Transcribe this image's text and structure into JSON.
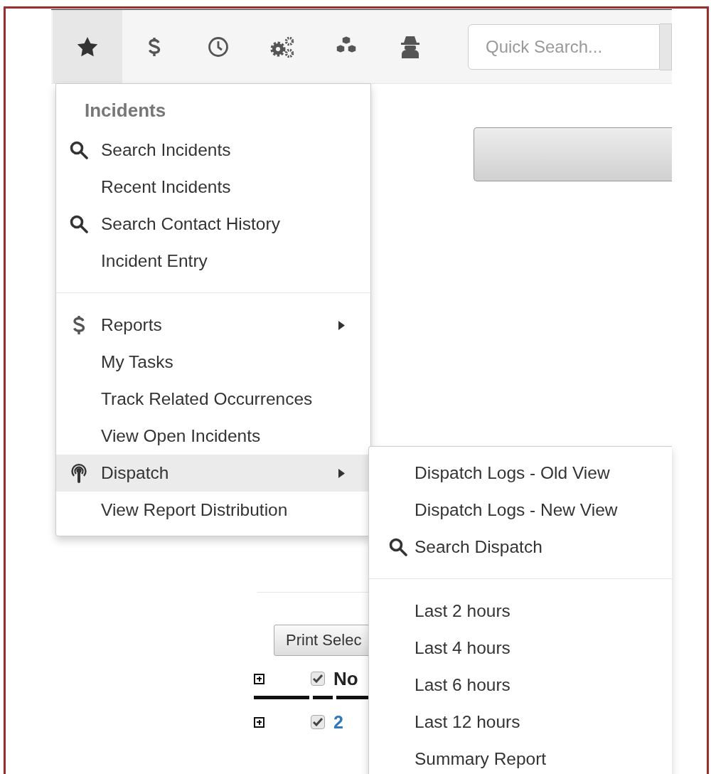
{
  "toolbar": {
    "tabs": [
      {
        "kind": "star",
        "selected": true
      },
      {
        "kind": "dollar",
        "selected": false
      },
      {
        "kind": "clock",
        "selected": false
      },
      {
        "kind": "cogs",
        "selected": false
      },
      {
        "kind": "cubes",
        "selected": false
      },
      {
        "kind": "agent",
        "selected": false
      }
    ],
    "search": {
      "placeholder": "Quick Search..."
    }
  },
  "menu": {
    "header": "Incidents",
    "sections": [
      [
        {
          "label": "Search Incidents",
          "kind": "search",
          "has_submenu": false,
          "selected": false
        },
        {
          "label": "Recent Incidents",
          "kind": "plain",
          "has_submenu": false,
          "selected": false
        },
        {
          "label": "Search Contact History",
          "kind": "search",
          "has_submenu": false,
          "selected": false
        },
        {
          "label": "Incident Entry",
          "kind": "plain",
          "has_submenu": false,
          "selected": false
        }
      ],
      [
        {
          "label": "Reports",
          "kind": "dollar",
          "has_submenu": true,
          "selected": false
        },
        {
          "label": "My Tasks",
          "kind": "plain",
          "has_submenu": false,
          "selected": false
        },
        {
          "label": "Track Related Occurrences",
          "kind": "plain",
          "has_submenu": false,
          "selected": false
        },
        {
          "label": "View Open Incidents",
          "kind": "plain",
          "has_submenu": false,
          "selected": false
        },
        {
          "label": "Dispatch",
          "kind": "broadcast",
          "has_submenu": true,
          "selected": true
        },
        {
          "label": "View Report Distribution",
          "kind": "plain",
          "has_submenu": false,
          "selected": false
        }
      ]
    ]
  },
  "submenu": {
    "sections": [
      [
        {
          "label": "Dispatch Logs - Old View",
          "kind": "plain"
        },
        {
          "label": "Dispatch Logs - New View",
          "kind": "plain"
        },
        {
          "label": "Search Dispatch",
          "kind": "search"
        }
      ],
      [
        {
          "label": "Last 2 hours",
          "kind": "plain"
        },
        {
          "label": "Last 4 hours",
          "kind": "plain"
        },
        {
          "label": "Last 6 hours",
          "kind": "plain"
        },
        {
          "label": "Last 12 hours",
          "kind": "plain"
        },
        {
          "label": "Summary Report",
          "kind": "plain"
        }
      ]
    ]
  },
  "page": {
    "print_button": "Print Selec",
    "table": {
      "header": {
        "label": "No",
        "checked": true
      },
      "rows": [
        {
          "value": "2",
          "checked": true
        }
      ]
    }
  }
}
